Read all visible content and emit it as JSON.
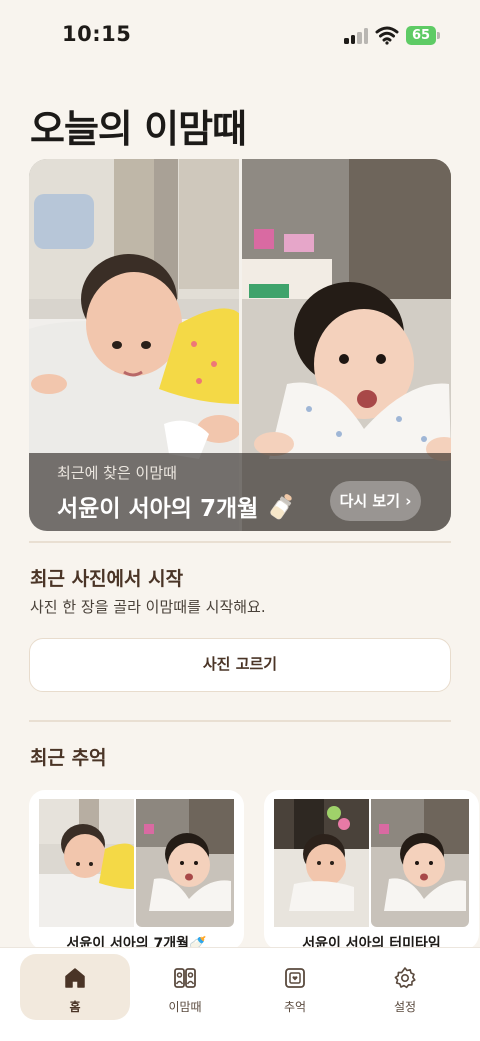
{
  "status_bar": {
    "time": "10:15",
    "battery": "65"
  },
  "page_title": "오늘의 이맘때",
  "hero": {
    "subtitle": "최근에 찾은 이맘때",
    "title": "서윤이 서아의 7개월",
    "title_icon": "baby-bottle-icon",
    "button_label": "다시 보기 ›"
  },
  "start_section": {
    "title": "최근 사진에서 시작",
    "description": "사진 한 장을 골라 이맘때를 시작해요.",
    "button_label": "사진 고르기"
  },
  "memories_section": {
    "title": "최근 추억",
    "items": [
      {
        "title": "서윤이 서아의 7개월🍼"
      },
      {
        "title": "서윤이 서아의 터미타임"
      }
    ]
  },
  "tab_bar": {
    "tabs": [
      {
        "label": "홈",
        "icon": "home-icon",
        "active": true
      },
      {
        "label": "이맘때",
        "icon": "compare-icon",
        "active": false
      },
      {
        "label": "추억",
        "icon": "album-icon",
        "active": false
      },
      {
        "label": "설정",
        "icon": "gear-icon",
        "active": false
      }
    ]
  },
  "colors": {
    "background": "#f8f4ee",
    "accent_brown": "#4a3426",
    "battery_green": "#5ecb65",
    "active_tab": "#f2e9dd"
  }
}
